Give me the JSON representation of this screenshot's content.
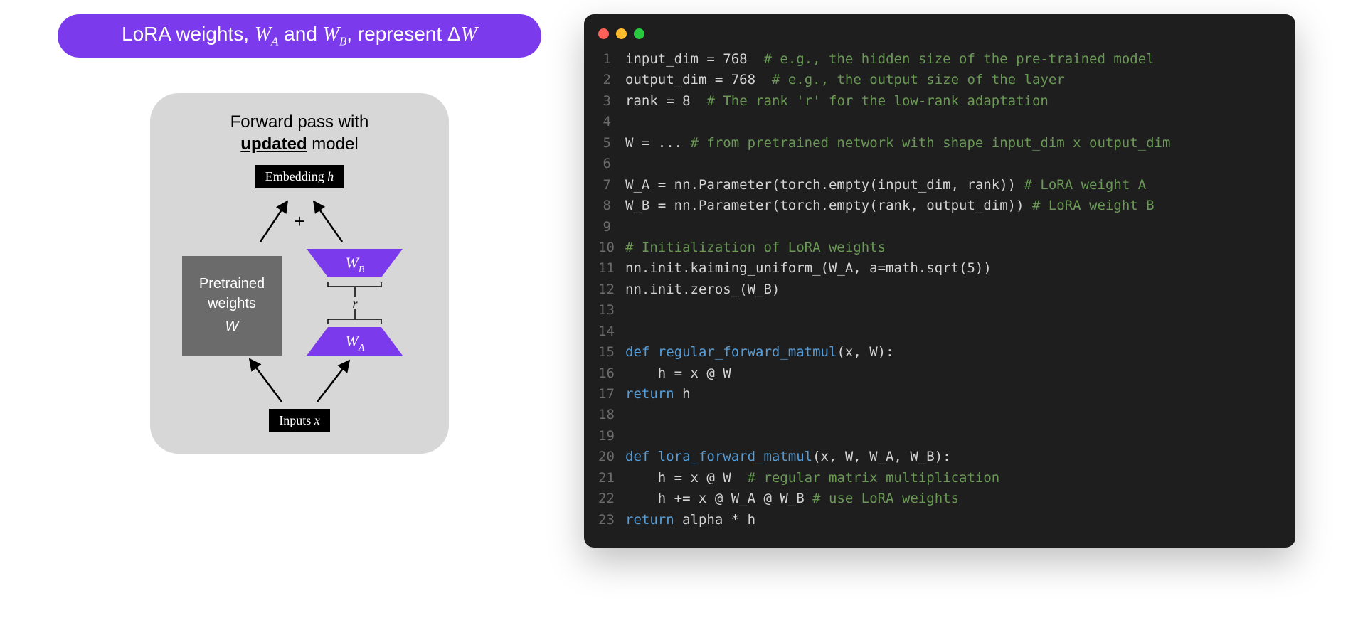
{
  "colors": {
    "accent": "#7c3aed",
    "editor_bg": "#1e1e1e",
    "comment": "#6a9955",
    "keyword": "#569cd6"
  },
  "title": {
    "prefix": "LoRA weights, ",
    "wa_base": "W",
    "wa_sub": "A",
    "mid": " and ",
    "wb_base": "W",
    "wb_sub": "B",
    "suffix": ", represent Δ",
    "dw": "W"
  },
  "diagram": {
    "fwd_line1": "Forward pass with",
    "fwd_updated": "updated",
    "fwd_model": " model",
    "embedding_label": "Embedding ",
    "embedding_var": "h",
    "plus": "+",
    "pretrained_l1": "Pretrained",
    "pretrained_l2": "weights",
    "pretrained_var": "W",
    "wb_base": "W",
    "wb_sub": "B",
    "r_label": "r",
    "wa_base": "W",
    "wa_sub": "A",
    "inputs_label": "Inputs ",
    "inputs_var": "x"
  },
  "code": {
    "lines": [
      {
        "n": 1,
        "segments": [
          [
            "id",
            "input_dim "
          ],
          [
            "op",
            "= "
          ],
          [
            "num",
            "768"
          ],
          [
            "id",
            "  "
          ],
          [
            "cmt",
            "# e.g., the hidden size of the pre-trained model"
          ]
        ]
      },
      {
        "n": 2,
        "segments": [
          [
            "id",
            "output_dim "
          ],
          [
            "op",
            "= "
          ],
          [
            "num",
            "768"
          ],
          [
            "id",
            "  "
          ],
          [
            "cmt",
            "# e.g., the output size of the layer"
          ]
        ]
      },
      {
        "n": 3,
        "segments": [
          [
            "id",
            "rank "
          ],
          [
            "op",
            "= "
          ],
          [
            "num",
            "8"
          ],
          [
            "id",
            "  "
          ],
          [
            "cmt",
            "# The rank 'r' for the low-rank adaptation"
          ]
        ]
      },
      {
        "n": 4,
        "segments": []
      },
      {
        "n": 5,
        "segments": [
          [
            "id",
            "W "
          ],
          [
            "op",
            "= ... "
          ],
          [
            "cmt",
            "# from pretrained network with shape input_dim x output_dim"
          ]
        ]
      },
      {
        "n": 6,
        "segments": []
      },
      {
        "n": 7,
        "segments": [
          [
            "id",
            "W_A "
          ],
          [
            "op",
            "= "
          ],
          [
            "id",
            "nn.Parameter(torch.empty(input_dim, rank)) "
          ],
          [
            "cmt",
            "# LoRA weight A"
          ]
        ]
      },
      {
        "n": 8,
        "segments": [
          [
            "id",
            "W_B "
          ],
          [
            "op",
            "= "
          ],
          [
            "id",
            "nn.Parameter(torch.empty(rank, output_dim)) "
          ],
          [
            "cmt",
            "# LoRA weight B"
          ]
        ]
      },
      {
        "n": 9,
        "segments": []
      },
      {
        "n": 10,
        "segments": [
          [
            "cmt",
            "# Initialization of LoRA weights"
          ]
        ]
      },
      {
        "n": 11,
        "segments": [
          [
            "id",
            "nn.init.kaiming_uniform_(W_A, a=math.sqrt("
          ],
          [
            "num",
            "5"
          ],
          [
            "id",
            "))"
          ]
        ]
      },
      {
        "n": 12,
        "segments": [
          [
            "id",
            "nn.init.zeros_(W_B)"
          ]
        ]
      },
      {
        "n": 13,
        "segments": []
      },
      {
        "n": 14,
        "segments": []
      },
      {
        "n": 15,
        "segments": [
          [
            "kw",
            "def "
          ],
          [
            "fn",
            "regular_forward_matmul"
          ],
          [
            "id",
            "(x, W):"
          ]
        ]
      },
      {
        "n": 16,
        "segments": [
          [
            "id",
            "    h "
          ],
          [
            "op",
            "= "
          ],
          [
            "id",
            "x @ W"
          ]
        ]
      },
      {
        "n": 17,
        "segments": [
          [
            "kw",
            "return "
          ],
          [
            "id",
            "h"
          ]
        ]
      },
      {
        "n": 18,
        "segments": []
      },
      {
        "n": 19,
        "segments": []
      },
      {
        "n": 20,
        "segments": [
          [
            "kw",
            "def "
          ],
          [
            "fn",
            "lora_forward_matmul"
          ],
          [
            "id",
            "(x, W, W_A, W_B):"
          ]
        ]
      },
      {
        "n": 21,
        "segments": [
          [
            "id",
            "    h "
          ],
          [
            "op",
            "= "
          ],
          [
            "id",
            "x @ W  "
          ],
          [
            "cmt",
            "# regular matrix multiplication"
          ]
        ]
      },
      {
        "n": 22,
        "segments": [
          [
            "id",
            "    h "
          ],
          [
            "op",
            "+= "
          ],
          [
            "id",
            "x @ W_A @ W_B "
          ],
          [
            "cmt",
            "# use LoRA weights"
          ]
        ]
      },
      {
        "n": 23,
        "segments": [
          [
            "kw",
            "return "
          ],
          [
            "id",
            "alpha * h"
          ]
        ]
      }
    ]
  }
}
